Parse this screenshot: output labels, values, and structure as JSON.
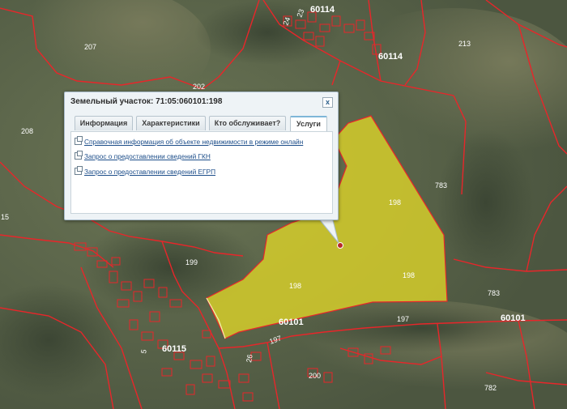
{
  "map": {
    "parcel_labels": [
      "207",
      "202",
      "208",
      "213",
      "15",
      "199",
      "783",
      "197",
      "200",
      "782",
      "24",
      "23",
      "5",
      "26",
      "197"
    ],
    "quarter_labels": [
      "60114",
      "60114",
      "60115",
      "60101",
      "60101"
    ],
    "selected_parcel_labels": [
      "198",
      "198",
      "198"
    ],
    "colors": {
      "boundary": "#e8262a",
      "selected_fill": "#d9d12a",
      "background": "#56604a"
    }
  },
  "popup": {
    "title": "Земельный участок: 71:05:060101:198",
    "close_label": "x",
    "tabs": [
      {
        "label": "Информация"
      },
      {
        "label": "Характеристики"
      },
      {
        "label": "Кто обслуживает?"
      },
      {
        "label": "Услуги"
      }
    ],
    "active_tab": "Услуги",
    "links": [
      {
        "text": "Справочная информация об объекте недвижимости в режиме онлайн",
        "icon": "external-link-icon"
      },
      {
        "text": "Запрос о предоставлении сведений ГКН",
        "icon": "external-link-icon"
      },
      {
        "text": "Запрос о предоставлении сведений ЕГРП",
        "icon": "external-link-icon"
      }
    ]
  }
}
